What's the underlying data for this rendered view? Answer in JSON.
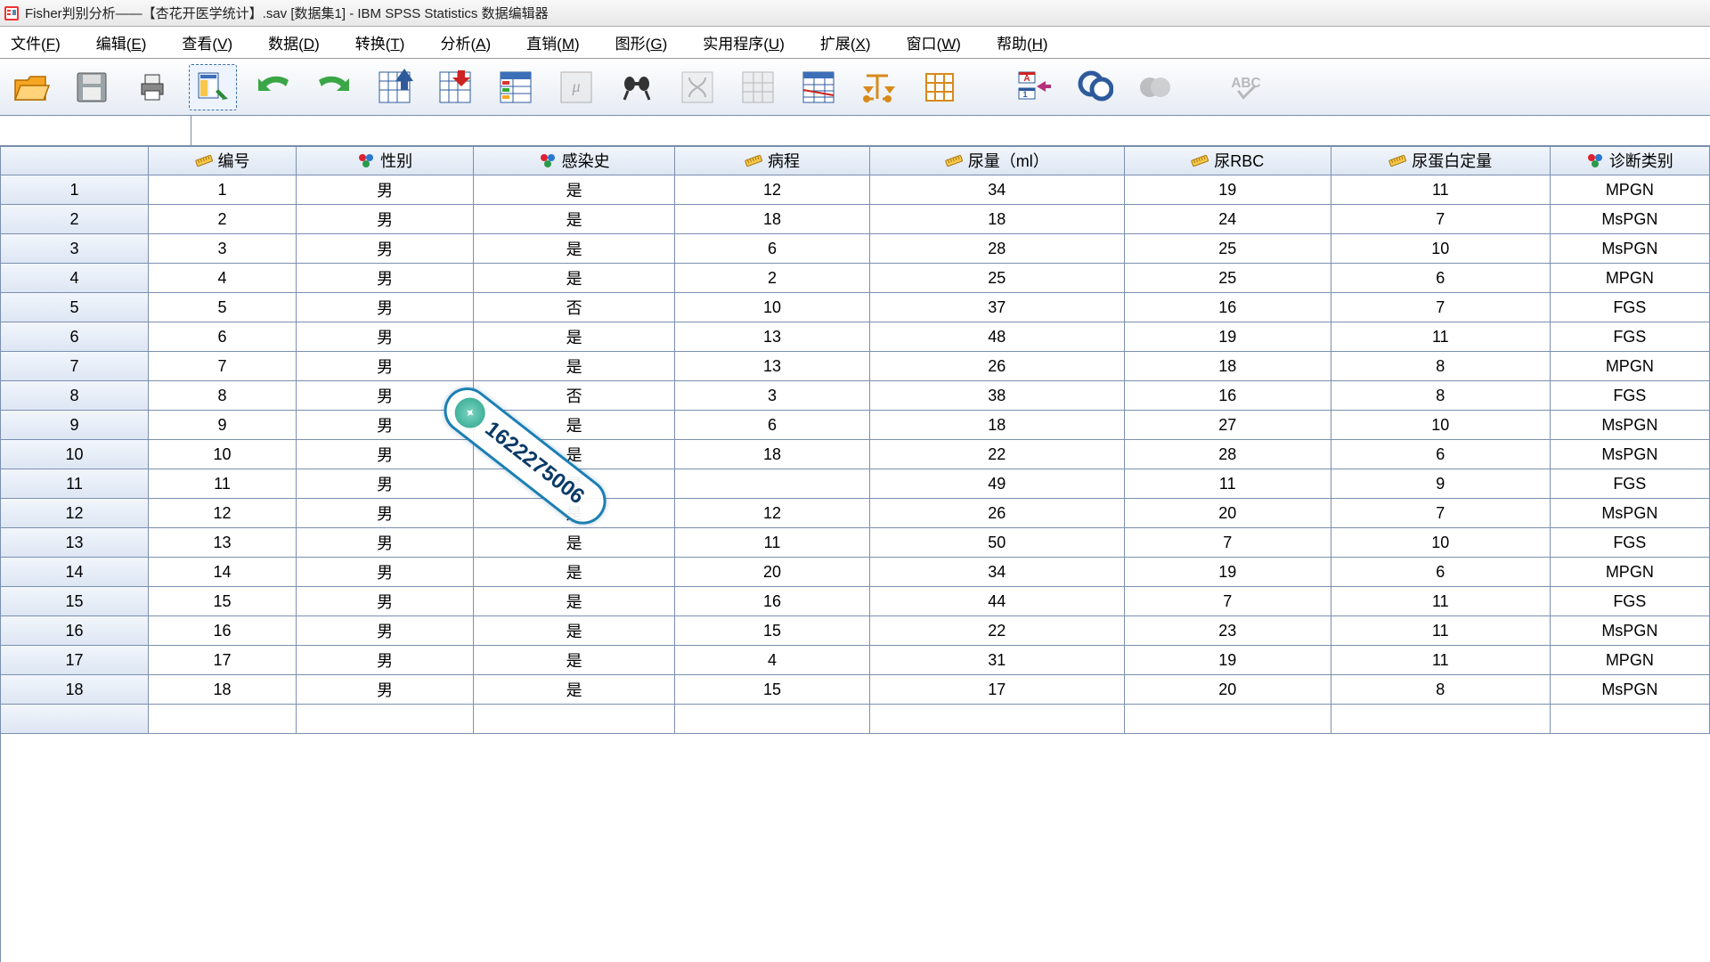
{
  "title": "Fisher判别分析——【杏花开医学统计】.sav [数据集1] - IBM SPSS Statistics 数据编辑器",
  "menu": {
    "file": {
      "label": "文件",
      "accel": "F"
    },
    "edit": {
      "label": "编辑",
      "accel": "E"
    },
    "view": {
      "label": "查看",
      "accel": "V"
    },
    "data": {
      "label": "数据",
      "accel": "D"
    },
    "transform": {
      "label": "转换",
      "accel": "T"
    },
    "analyze": {
      "label": "分析",
      "accel": "A"
    },
    "direct": {
      "label": "直销",
      "accel": "M"
    },
    "graphs": {
      "label": "图形",
      "accel": "G"
    },
    "util": {
      "label": "实用程序",
      "accel": "U"
    },
    "ext": {
      "label": "扩展",
      "accel": "X"
    },
    "window": {
      "label": "窗口",
      "accel": "W"
    },
    "help": {
      "label": "帮助",
      "accel": "H"
    }
  },
  "columns": [
    {
      "name": "编号",
      "type": "scale"
    },
    {
      "name": "性别",
      "type": "nominal"
    },
    {
      "name": "感染史",
      "type": "nominal"
    },
    {
      "name": "病程",
      "type": "scale"
    },
    {
      "name": "尿量（ml）",
      "type": "scale"
    },
    {
      "name": "尿RBC",
      "type": "scale"
    },
    {
      "name": "尿蛋白定量",
      "type": "scale"
    },
    {
      "name": "诊断类别",
      "type": "nominal"
    }
  ],
  "rows": [
    {
      "n": "1",
      "编号": "1",
      "性别": "男",
      "感染史": "是",
      "病程": "12",
      "尿量": "34",
      "尿RBC": "19",
      "尿蛋白": "11",
      "诊断": "MPGN"
    },
    {
      "n": "2",
      "编号": "2",
      "性别": "男",
      "感染史": "是",
      "病程": "18",
      "尿量": "18",
      "尿RBC": "24",
      "尿蛋白": "7",
      "诊断": "MsPGN"
    },
    {
      "n": "3",
      "编号": "3",
      "性别": "男",
      "感染史": "是",
      "病程": "6",
      "尿量": "28",
      "尿RBC": "25",
      "尿蛋白": "10",
      "诊断": "MsPGN"
    },
    {
      "n": "4",
      "编号": "4",
      "性别": "男",
      "感染史": "是",
      "病程": "2",
      "尿量": "25",
      "尿RBC": "25",
      "尿蛋白": "6",
      "诊断": "MPGN"
    },
    {
      "n": "5",
      "编号": "5",
      "性别": "男",
      "感染史": "否",
      "病程": "10",
      "尿量": "37",
      "尿RBC": "16",
      "尿蛋白": "7",
      "诊断": "FGS"
    },
    {
      "n": "6",
      "编号": "6",
      "性别": "男",
      "感染史": "是",
      "病程": "13",
      "尿量": "48",
      "尿RBC": "19",
      "尿蛋白": "11",
      "诊断": "FGS"
    },
    {
      "n": "7",
      "编号": "7",
      "性别": "男",
      "感染史": "是",
      "病程": "13",
      "尿量": "26",
      "尿RBC": "18",
      "尿蛋白": "8",
      "诊断": "MPGN"
    },
    {
      "n": "8",
      "编号": "8",
      "性别": "男",
      "感染史": "否",
      "病程": "3",
      "尿量": "38",
      "尿RBC": "16",
      "尿蛋白": "8",
      "诊断": "FGS"
    },
    {
      "n": "9",
      "编号": "9",
      "性别": "男",
      "感染史": "是",
      "病程": "6",
      "尿量": "18",
      "尿RBC": "27",
      "尿蛋白": "10",
      "诊断": "MsPGN"
    },
    {
      "n": "10",
      "编号": "10",
      "性别": "男",
      "感染史": "是",
      "病程": "18",
      "尿量": "22",
      "尿RBC": "28",
      "尿蛋白": "6",
      "诊断": "MsPGN"
    },
    {
      "n": "11",
      "编号": "11",
      "性别": "男",
      "感染史": "是",
      "病程": "",
      "尿量": "49",
      "尿RBC": "11",
      "尿蛋白": "9",
      "诊断": "FGS"
    },
    {
      "n": "12",
      "编号": "12",
      "性别": "男",
      "感染史": "是",
      "病程": "12",
      "尿量": "26",
      "尿RBC": "20",
      "尿蛋白": "7",
      "诊断": "MsPGN"
    },
    {
      "n": "13",
      "编号": "13",
      "性别": "男",
      "感染史": "是",
      "病程": "11",
      "尿量": "50",
      "尿RBC": "7",
      "尿蛋白": "10",
      "诊断": "FGS"
    },
    {
      "n": "14",
      "编号": "14",
      "性别": "男",
      "感染史": "是",
      "病程": "20",
      "尿量": "34",
      "尿RBC": "19",
      "尿蛋白": "6",
      "诊断": "MPGN"
    },
    {
      "n": "15",
      "编号": "15",
      "性别": "男",
      "感染史": "是",
      "病程": "16",
      "尿量": "44",
      "尿RBC": "7",
      "尿蛋白": "11",
      "诊断": "FGS"
    },
    {
      "n": "16",
      "编号": "16",
      "性别": "男",
      "感染史": "是",
      "病程": "15",
      "尿量": "22",
      "尿RBC": "23",
      "尿蛋白": "11",
      "诊断": "MsPGN"
    },
    {
      "n": "17",
      "编号": "17",
      "性别": "男",
      "感染史": "是",
      "病程": "4",
      "尿量": "31",
      "尿RBC": "19",
      "尿蛋白": "11",
      "诊断": "MPGN"
    },
    {
      "n": "18",
      "编号": "18",
      "性别": "男",
      "感染史": "是",
      "病程": "15",
      "尿量": "17",
      "尿RBC": "20",
      "尿蛋白": "8",
      "诊断": "MsPGN"
    }
  ],
  "watermark": {
    "text": "1622275006"
  }
}
